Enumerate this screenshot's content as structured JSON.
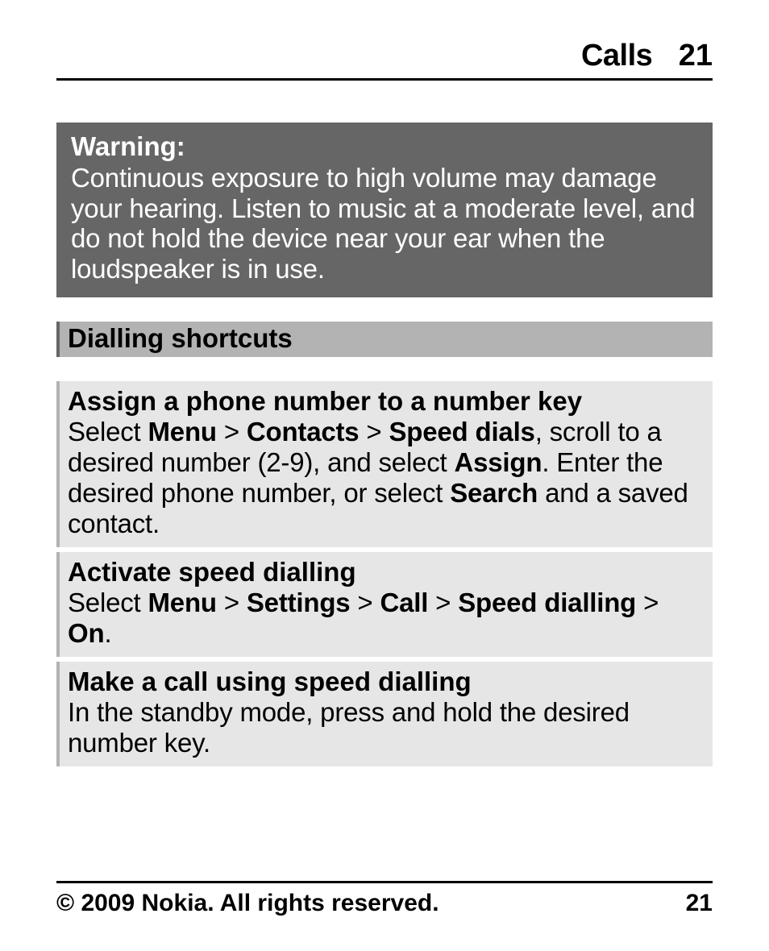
{
  "header": {
    "section": "Calls",
    "page": "21"
  },
  "warning": {
    "label": "Warning:",
    "text": "Continuous exposure to high volume may damage your hearing. Listen to music at a moderate level, and do not hold the device near your ear when the loudspeaker is in use."
  },
  "section_title": "Dialling shortcuts",
  "blocks": {
    "assign": {
      "title": "Assign a phone number to a number key",
      "t1": "Select ",
      "b1": "Menu",
      "s1": " > ",
      "b2": "Contacts",
      "s2": " > ",
      "b3": "Speed dials",
      "t2": ", scroll to a desired number (2-9), and select ",
      "b4": "Assign",
      "t3": ". Enter the desired phone number, or select ",
      "b5": "Search",
      "t4": " and a saved contact."
    },
    "activate": {
      "title": "Activate speed dialling",
      "t1": "Select ",
      "b1": "Menu",
      "s1": " > ",
      "b2": "Settings",
      "s2": " > ",
      "b3": "Call",
      "s3": " > ",
      "b4": "Speed dialling",
      "s4": " > ",
      "b5": "On",
      "t2": "."
    },
    "make": {
      "title": "Make a call using speed dialling",
      "text": "In the standby mode, press and hold the desired number key."
    }
  },
  "footer": {
    "copyright": "© 2009 Nokia. All rights reserved.",
    "page": "21"
  }
}
